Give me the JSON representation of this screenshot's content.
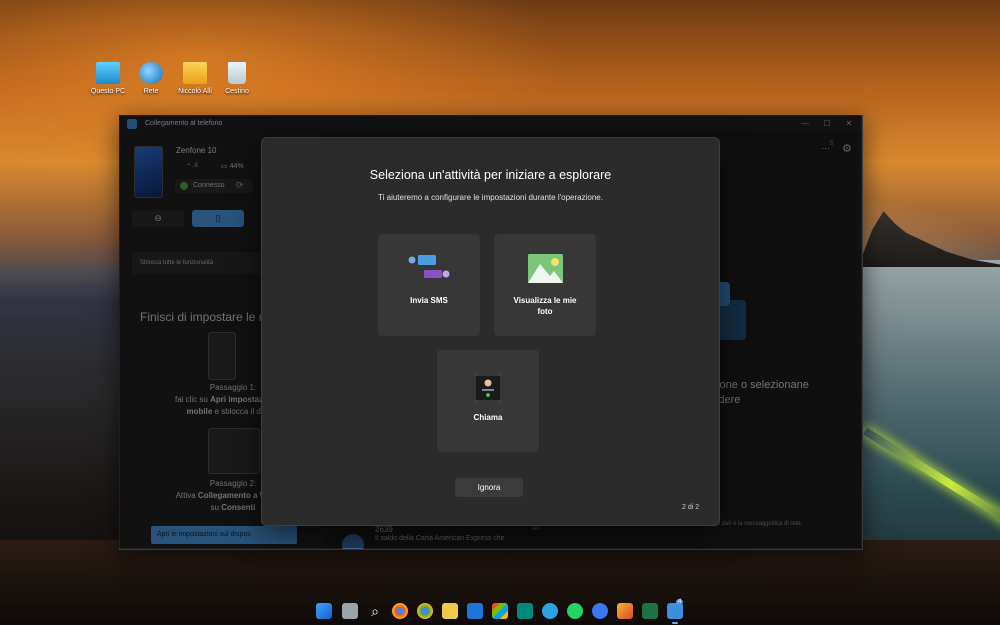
{
  "desktop": {
    "icons": [
      {
        "label": "Questo PC",
        "icon": "computer-icon"
      },
      {
        "label": "Rete",
        "icon": "network-icon"
      },
      {
        "label": "Niccolò Alli",
        "icon": "user-folder-icon"
      },
      {
        "label": "Cestino",
        "icon": "recycle-bin-icon"
      }
    ]
  },
  "window": {
    "title": "Collegamento al telefono",
    "controls": {
      "minimize": "—",
      "maximize": "☐",
      "close": "✕"
    }
  },
  "sidebar": {
    "device_name": "Zenfone 10",
    "battery": "44%",
    "connection_status": "Connesso",
    "unlock_label": "Sblocca tutte le funzionalità",
    "finish_title": "Finisci di impostare le n",
    "step1": {
      "heading": "Passaggio 1:",
      "line1_prefix": "fai clic su ",
      "line1_bold": "Apri impostazioni sul",
      "line2_bold": "mobile",
      "line2_suffix": " e sblocca il dispos"
    },
    "step2": {
      "heading": "Passaggio 2:",
      "line1_prefix": "Attiva ",
      "line1_bold": "Collegamento a Window",
      "line2_prefix": "su ",
      "line2_bold": "Consenti"
    },
    "open_settings_button": "Apri le impostazioni sul dispos"
  },
  "main": {
    "notification_count": "5",
    "right_text_line1": "zazione o selezionane",
    "right_text_line2": "pondere",
    "footer_hint": "Potrebbero essere applicate tariffe per i dati e la messaggistica di rete.",
    "message": {
      "number": "2639",
      "preview": "Il saldo della Carta American Express che",
      "time": "ieri"
    }
  },
  "modal": {
    "title": "Seleziona un'attività per iniziare a esplorare",
    "subtitle": "Ti aiuteremo a configurare le impostazioni durante l'operazione.",
    "cards": [
      {
        "label": "Invia SMS",
        "icon": "messages-icon"
      },
      {
        "label_line1": "Visualizza le mie",
        "label_line2": "foto",
        "icon": "photos-icon"
      },
      {
        "label": "Chiama",
        "icon": "call-icon"
      }
    ],
    "skip_button": "Ignora",
    "page_indicator": "2 di 2"
  },
  "taskbar": {
    "icons": [
      "start-icon",
      "file-manager-icon",
      "search-icon",
      "chrome-icon",
      "chrome-icon",
      "file-explorer-icon",
      "trello-icon",
      "store-icon",
      "meet-icon",
      "telegram-icon",
      "whatsapp-icon",
      "signal-icon",
      "winamp-icon",
      "excel-icon",
      "phone-link-icon"
    ],
    "phone_link_badge": "4"
  },
  "colors": {
    "accent": "#4a9ae0",
    "modal_bg": "#2b2b2b",
    "card_bg": "#373737",
    "window_bg": "#202020"
  }
}
